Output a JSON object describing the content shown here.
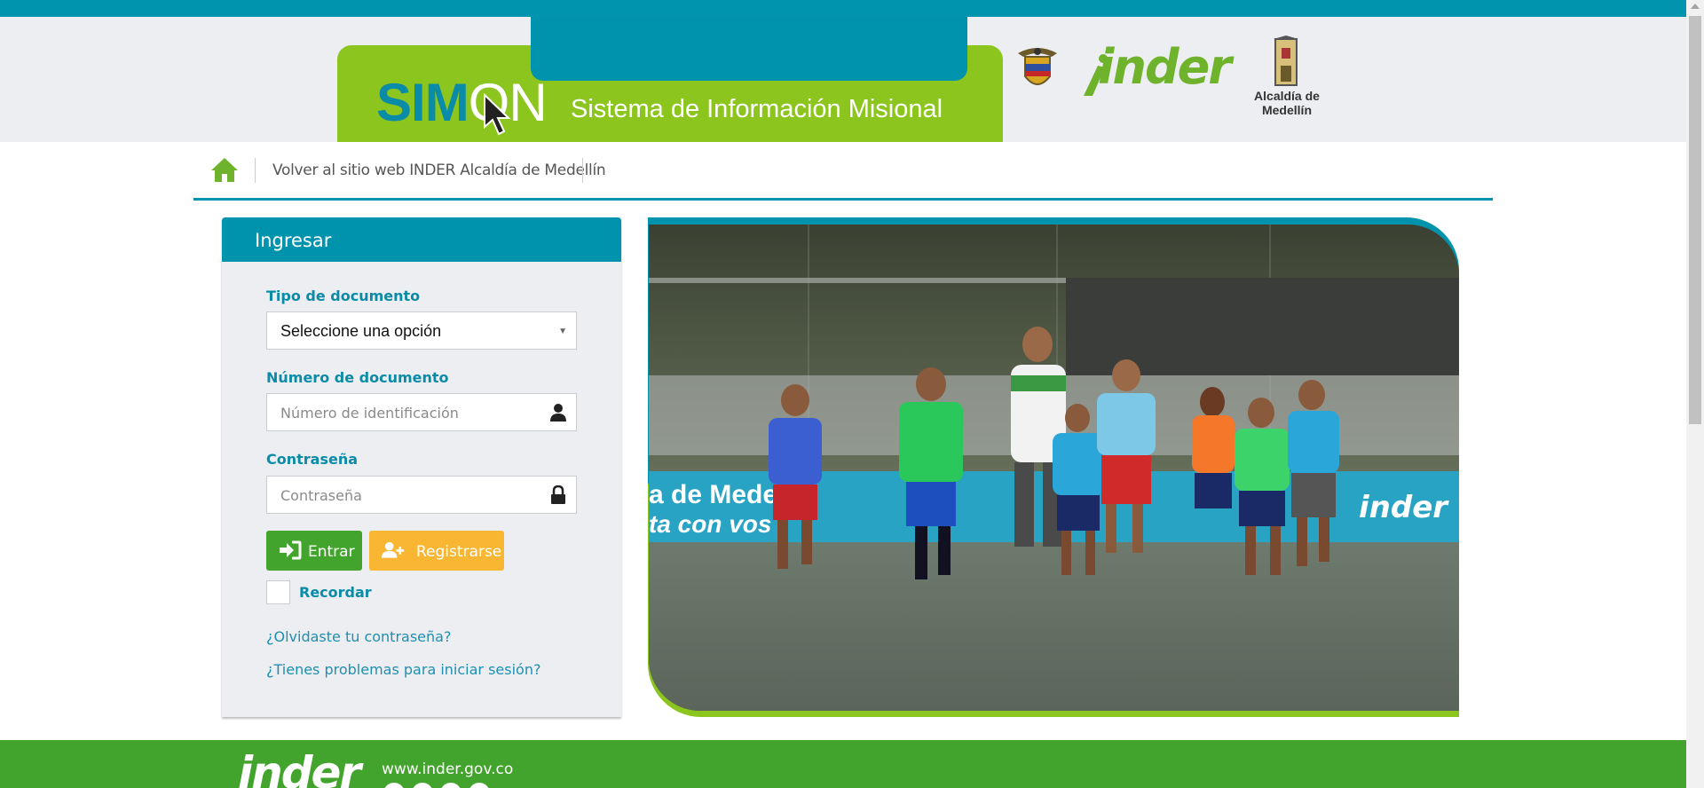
{
  "header": {
    "brand": "SIM",
    "brand_on": "ON",
    "subtitle": "Sistema de Información Misional",
    "inder_logo": "inder",
    "alcaldia_label": "Alcaldía de Medellín"
  },
  "nav": {
    "home_icon": "home-icon",
    "back_link": "Volver al sitio web INDER Alcaldía de Medellín"
  },
  "login": {
    "title": "Ingresar",
    "doc_type": {
      "label": "Tipo de documento",
      "value": "Seleccione una opción"
    },
    "doc_number": {
      "label": "Número de documento",
      "placeholder": "Número de identificación",
      "icon": "user-icon"
    },
    "password": {
      "label": "Contraseña",
      "placeholder": "Contraseña",
      "icon": "lock-icon"
    },
    "enter_button": "Entrar",
    "register_button": "Registrarse",
    "remember_label": "Recordar",
    "forgot_link": "¿Olvidaste tu contraseña?",
    "problems_link": "¿Tienes problemas para iniciar sesión?"
  },
  "photo": {
    "banner_text_1": "a de Medellín",
    "banner_text_2": "ta con vos",
    "banner_brand": "inder"
  },
  "footer": {
    "logo": "inder",
    "url": "www.inder.gov.co"
  },
  "colors": {
    "teal": "#0093ae",
    "lime": "#8bc51e",
    "green": "#42a42c",
    "orange": "#f8b633",
    "panel_bg": "#eceef2"
  }
}
